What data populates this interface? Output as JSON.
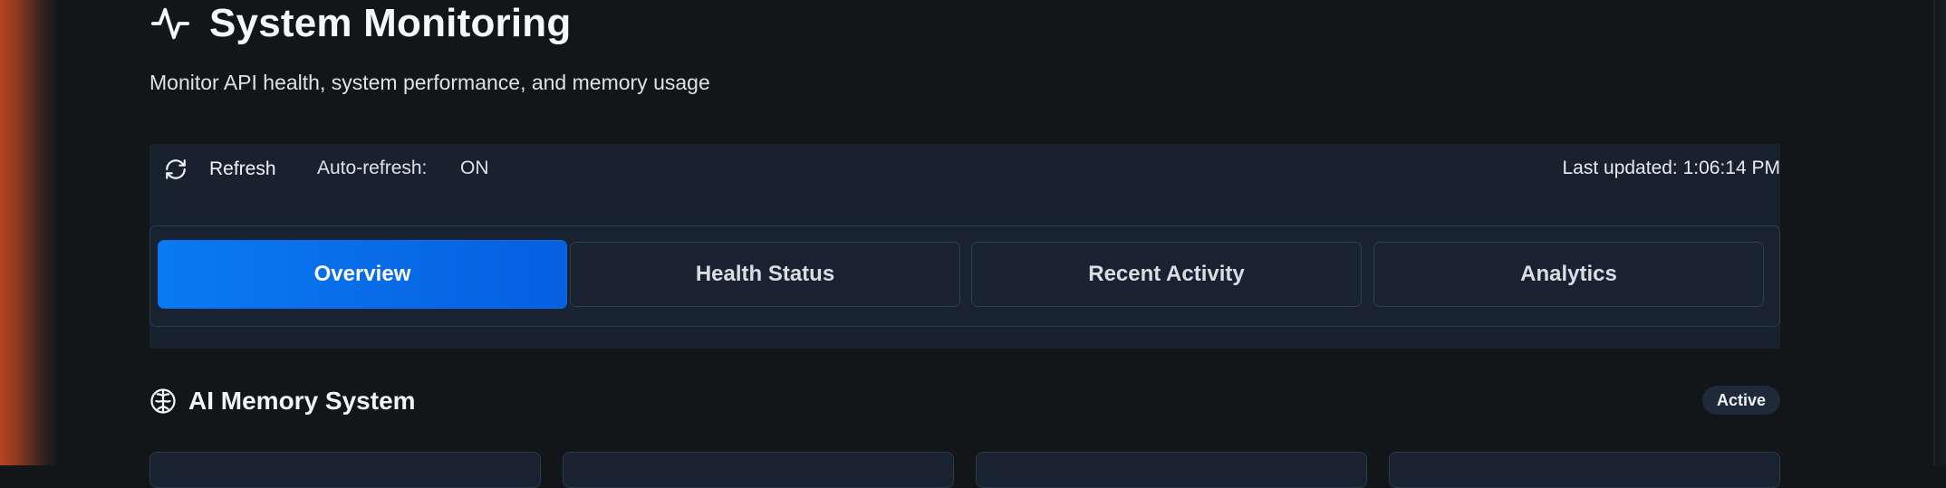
{
  "header": {
    "title": "System Monitoring",
    "subtitle": "Monitor API health, system performance, and memory usage",
    "icon": "activity-pulse-icon"
  },
  "toolbar": {
    "refresh_label": "Refresh",
    "refresh_icon": "refresh-icon",
    "auto_refresh_label": "Auto-refresh:",
    "auto_refresh_value": "ON",
    "last_updated": "Last updated: 1:06:14 PM"
  },
  "tabs": [
    {
      "label": "Overview",
      "active": true
    },
    {
      "label": "Health Status",
      "active": false
    },
    {
      "label": "Recent Activity",
      "active": false
    },
    {
      "label": "Analytics",
      "active": false
    }
  ],
  "memory_section": {
    "title": "AI Memory System",
    "icon": "brain-icon",
    "status": "Active"
  },
  "colors": {
    "background": "#121619",
    "panel": "#18222f",
    "accent": "#0a7af2",
    "border": "#2c3a4b",
    "left_glow": "#b4451e"
  }
}
